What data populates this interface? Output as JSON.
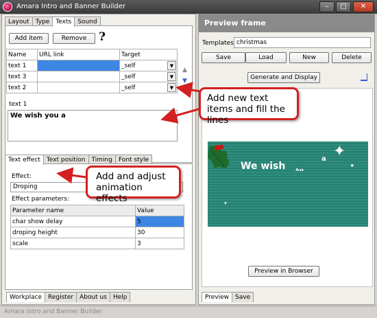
{
  "window": {
    "title": "Amara Intro and Banner Builder"
  },
  "left": {
    "top_tabs": [
      "Layout",
      "Type",
      "Texts",
      "Sound"
    ],
    "add_item": "Add item",
    "remove": "Remove",
    "help": "?",
    "text_table": {
      "headers": [
        "Name",
        "URL link",
        "Target"
      ],
      "rows": [
        {
          "name": "text 1",
          "url": "",
          "target": "_self"
        },
        {
          "name": "text 3",
          "url": "",
          "target": "_self"
        },
        {
          "name": "text 2",
          "url": "",
          "target": "_self"
        }
      ]
    },
    "text_label": "text 1",
    "text_value": "We wish you a",
    "effect_tabs": [
      "Text effect",
      "Text position",
      "Timing",
      "Font style"
    ],
    "effect_label": "Effect:",
    "effect_value": "Droping",
    "params_label": "Effect parameters:",
    "params_table": {
      "headers": [
        "Parameter name",
        "Value"
      ],
      "rows": [
        {
          "name": "char show delay",
          "value": "5"
        },
        {
          "name": "droping height",
          "value": "30"
        },
        {
          "name": "scale",
          "value": "3"
        }
      ]
    },
    "bottom_tabs": [
      "Workplace",
      "Register",
      "About us",
      "Help"
    ]
  },
  "right": {
    "header": "Preview frame",
    "templates_label": "Templates:",
    "templates_value": "christmas",
    "save": "Save",
    "load": "Load",
    "new": "New",
    "delete": "Delete",
    "generate": "Generate and Display",
    "banner_text": "We wish",
    "banner_partial": "yo",
    "banner_a": "a",
    "preview_browser": "Preview in Browser",
    "bottom_tabs": [
      "Preview",
      "Save"
    ]
  },
  "callouts": {
    "texts": "Add new text items and fill the lines",
    "effects": "Add and adjust animation effects"
  },
  "status": "Amara Intro and Banner Builder",
  "colors": {
    "accent": "#3d86e4",
    "callout_border": "#d32020",
    "banner_green": "#2e8a7a"
  }
}
